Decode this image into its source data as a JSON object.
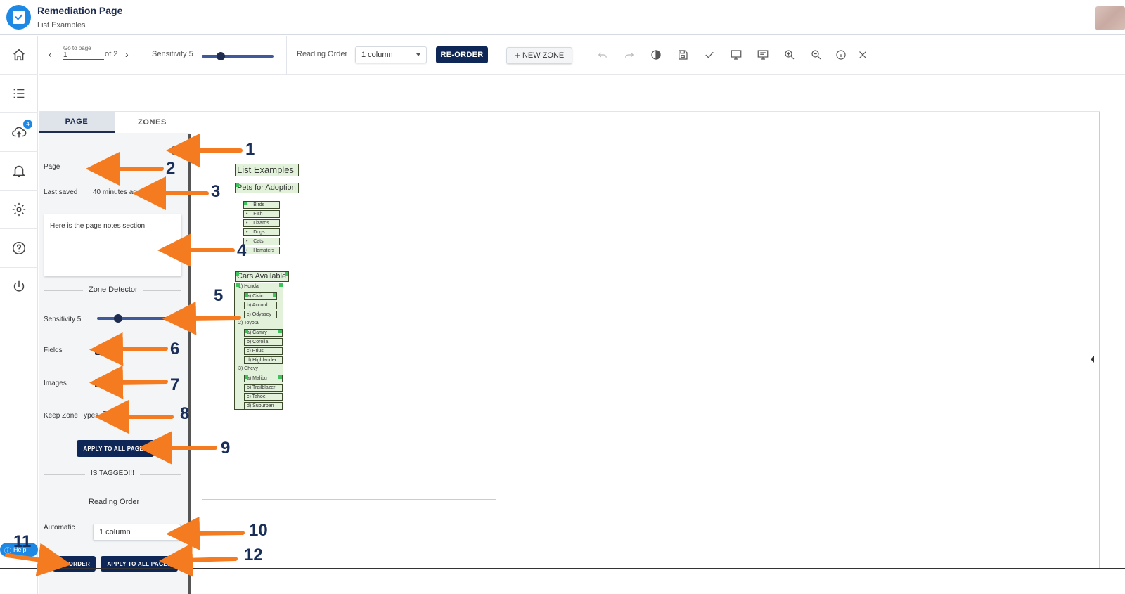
{
  "header": {
    "title": "Remediation Page",
    "subtitle": "List Examples"
  },
  "left_rail": {
    "upload_badge": "4"
  },
  "toolbar": {
    "go_to_page_caption": "Go to page",
    "page_value": "1",
    "page_of": "of 2",
    "sensitivity_label": "Sensitivity 5",
    "sensitivity_value": 5,
    "reading_order_label": "Reading Order",
    "reading_order_value": "1 column",
    "reorder_button": "RE-ORDER",
    "new_zone_button": "NEW ZONE"
  },
  "panel": {
    "tabs": [
      {
        "label": "PAGE",
        "active": true
      },
      {
        "label": "ZONES",
        "active": false
      }
    ],
    "page_label": "Page",
    "page_value": "1",
    "last_saved_label": "Last saved",
    "last_saved_value": "40 minutes ago",
    "notes": "Here is the page notes section!",
    "zone_detector_title": "Zone Detector",
    "sensitivity_label": "Sensitivity 5",
    "sensitivity_value": 5,
    "fields_label": "Fields",
    "fields_checked": true,
    "images_label": "Images",
    "images_checked": true,
    "keep_zone_types_label": "Keep Zone Types",
    "keep_zone_types_checked": false,
    "apply_all_button": "APPLY TO ALL PAGES",
    "is_tagged_text": "IS TAGGED!!!",
    "reading_order_title": "Reading Order",
    "automatic_label": "Automatic",
    "automatic_value": "1 column",
    "reorder_button": "RE-ORDER",
    "apply_all_button_2": "APPLY TO ALL PAGES",
    "help_label": "Help"
  },
  "document": {
    "title": "List Examples",
    "pets_heading": "Pets for Adoption",
    "pets": [
      "Birds",
      "Fish",
      "Lizards",
      "Dogs",
      "Cats",
      "Hamsters"
    ],
    "cars_heading": "Cars Available",
    "car_rows": [
      "1)  Honda",
      "a)  Civic",
      "b)  Accord",
      "c)  Odyssey",
      "2)  Toyota",
      "a)  Camry",
      "b)  Corolla",
      "c)  Prius",
      "d)  Highlander",
      "3)  Chevy",
      "a)  Malibu",
      "b)  Trailblazer",
      "c)  Tahoe",
      "d)  Suburban"
    ]
  },
  "annotations": [
    "1",
    "2",
    "3",
    "4",
    "5",
    "6",
    "7",
    "8",
    "9",
    "10",
    "11",
    "12"
  ],
  "colors": {
    "primary": "#0f2756",
    "accent": "#1e88e5",
    "annotation_arrow": "#f47b20",
    "annotation_number": "#1a2e5a",
    "zone_fill": "#e2f2da"
  }
}
